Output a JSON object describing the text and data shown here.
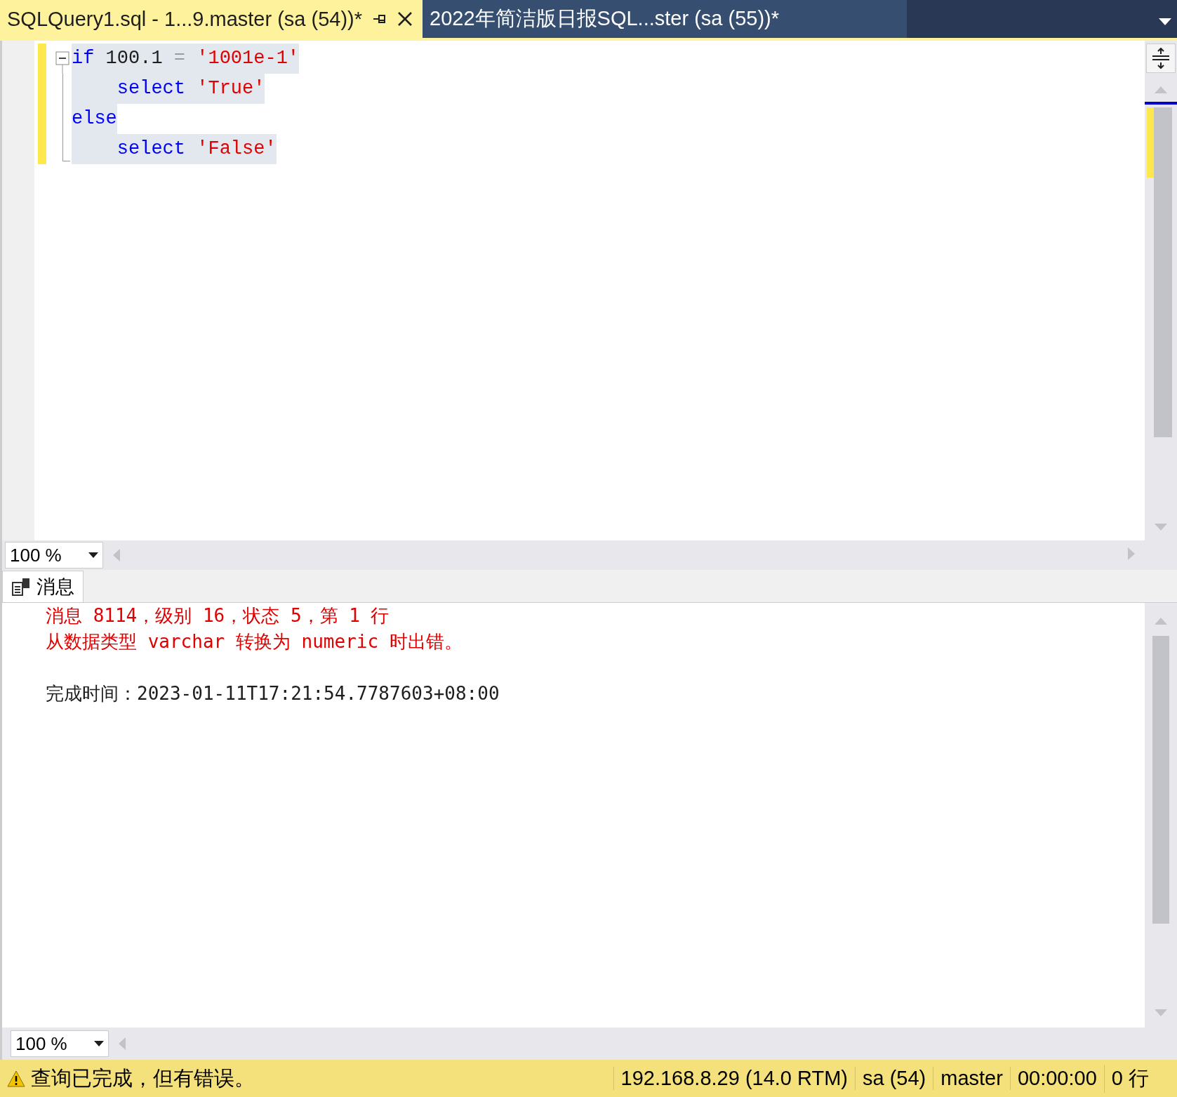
{
  "tabs": [
    {
      "label": "SQLQuery1.sql - 1...9.master (sa (54))*",
      "selected": true
    },
    {
      "label": "2022年简洁版日报SQL...ster (sa (55))*",
      "selected": false
    }
  ],
  "editor": {
    "lines": [
      {
        "changed": true,
        "selected": true,
        "tokens": [
          {
            "kind": "keyword",
            "text": "if"
          },
          {
            "kind": "plain",
            "text": " 100.1 "
          },
          {
            "kind": "operator",
            "text": "="
          },
          {
            "kind": "string",
            "text": " '1001e-1'"
          }
        ]
      },
      {
        "changed": true,
        "selected": true,
        "tokens": [
          {
            "kind": "keyword",
            "text": "    select"
          },
          {
            "kind": "string",
            "text": " 'True'"
          }
        ]
      },
      {
        "changed": true,
        "selected": true,
        "tokens": [
          {
            "kind": "keyword",
            "text": "else"
          }
        ]
      },
      {
        "changed": true,
        "selected": true,
        "tokens": [
          {
            "kind": "keyword",
            "text": "    select"
          },
          {
            "kind": "string",
            "text": " 'False'"
          }
        ]
      }
    ],
    "zoom": "100 %"
  },
  "results": {
    "tab": "消息",
    "messages": [
      {
        "kind": "error",
        "text": "消息 8114，级别 16，状态 5，第 1 行"
      },
      {
        "kind": "error",
        "text": "从数据类型 varchar 转换为 numeric 时出错。"
      },
      {
        "kind": "info",
        "text": "完成时间：2023-01-11T17:21:54.7787603+08:00"
      }
    ],
    "zoom": "100 %"
  },
  "status_bar": {
    "message": "查询已完成，但有错误。",
    "panels": [
      "192.168.8.29 (14.0 RTM)",
      "sa (54)",
      "master",
      "00:00:00",
      "0 行"
    ]
  }
}
